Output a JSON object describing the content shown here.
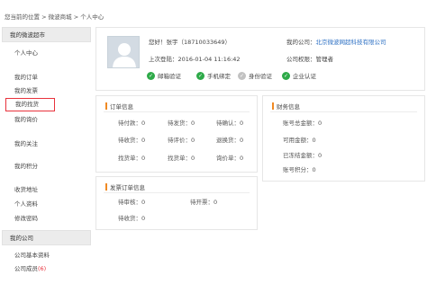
{
  "breadcrumb": {
    "prefix": "您当前的位置",
    "sep1": ">",
    "level1": "微波商城",
    "sep2": ">",
    "level2": "个人中心"
  },
  "sidebar": {
    "section1_title": "我的微波超市",
    "items1": [
      "个人中心",
      "我的订单",
      "我的发票",
      "我的找货",
      "我的询价",
      "我的关注",
      "我的积分",
      "收货地址",
      "个人资料",
      "修改密码"
    ],
    "section2_title": "我的公司",
    "items2": [
      "公司基本资料",
      "公司成员"
    ],
    "company_member_count": "(6)"
  },
  "profile": {
    "greeting": "您好！张宇（18710033649）",
    "last_login": "上次登陆：2016-01-04 11:16:42",
    "company_label": "我的公司：",
    "company_name": "北京微波网超科技有限公司",
    "position": "公司权限：管理者",
    "badges": [
      {
        "label": "邮箱验证",
        "verified": true
      },
      {
        "label": "手机绑定",
        "verified": true
      },
      {
        "label": "身份验证",
        "verified": false
      },
      {
        "label": "企业认证",
        "verified": true
      }
    ],
    "check_glyph": "✓"
  },
  "orders": {
    "title": "订单信息",
    "cells": [
      "待付款：0",
      "待发货：0",
      "待确认：0",
      "待收货：0",
      "待评价：0",
      "退换货：0",
      "找货单：0",
      "找货单：0",
      "询价单：0"
    ]
  },
  "invoices": {
    "title": "发票订单信息",
    "cells": [
      "待审核：0",
      "待开票：0",
      "待收货：0"
    ]
  },
  "finance": {
    "title": "财务信息",
    "rows": [
      "账号总金额：0",
      "可用金额：0",
      "已冻结金额：0",
      "账号积分：0"
    ]
  },
  "colors": {
    "accent_orange": "#f08a24",
    "highlight_red": "#e8323c",
    "link_blue": "#2b6fc3",
    "verified_green": "#2eaa49"
  }
}
